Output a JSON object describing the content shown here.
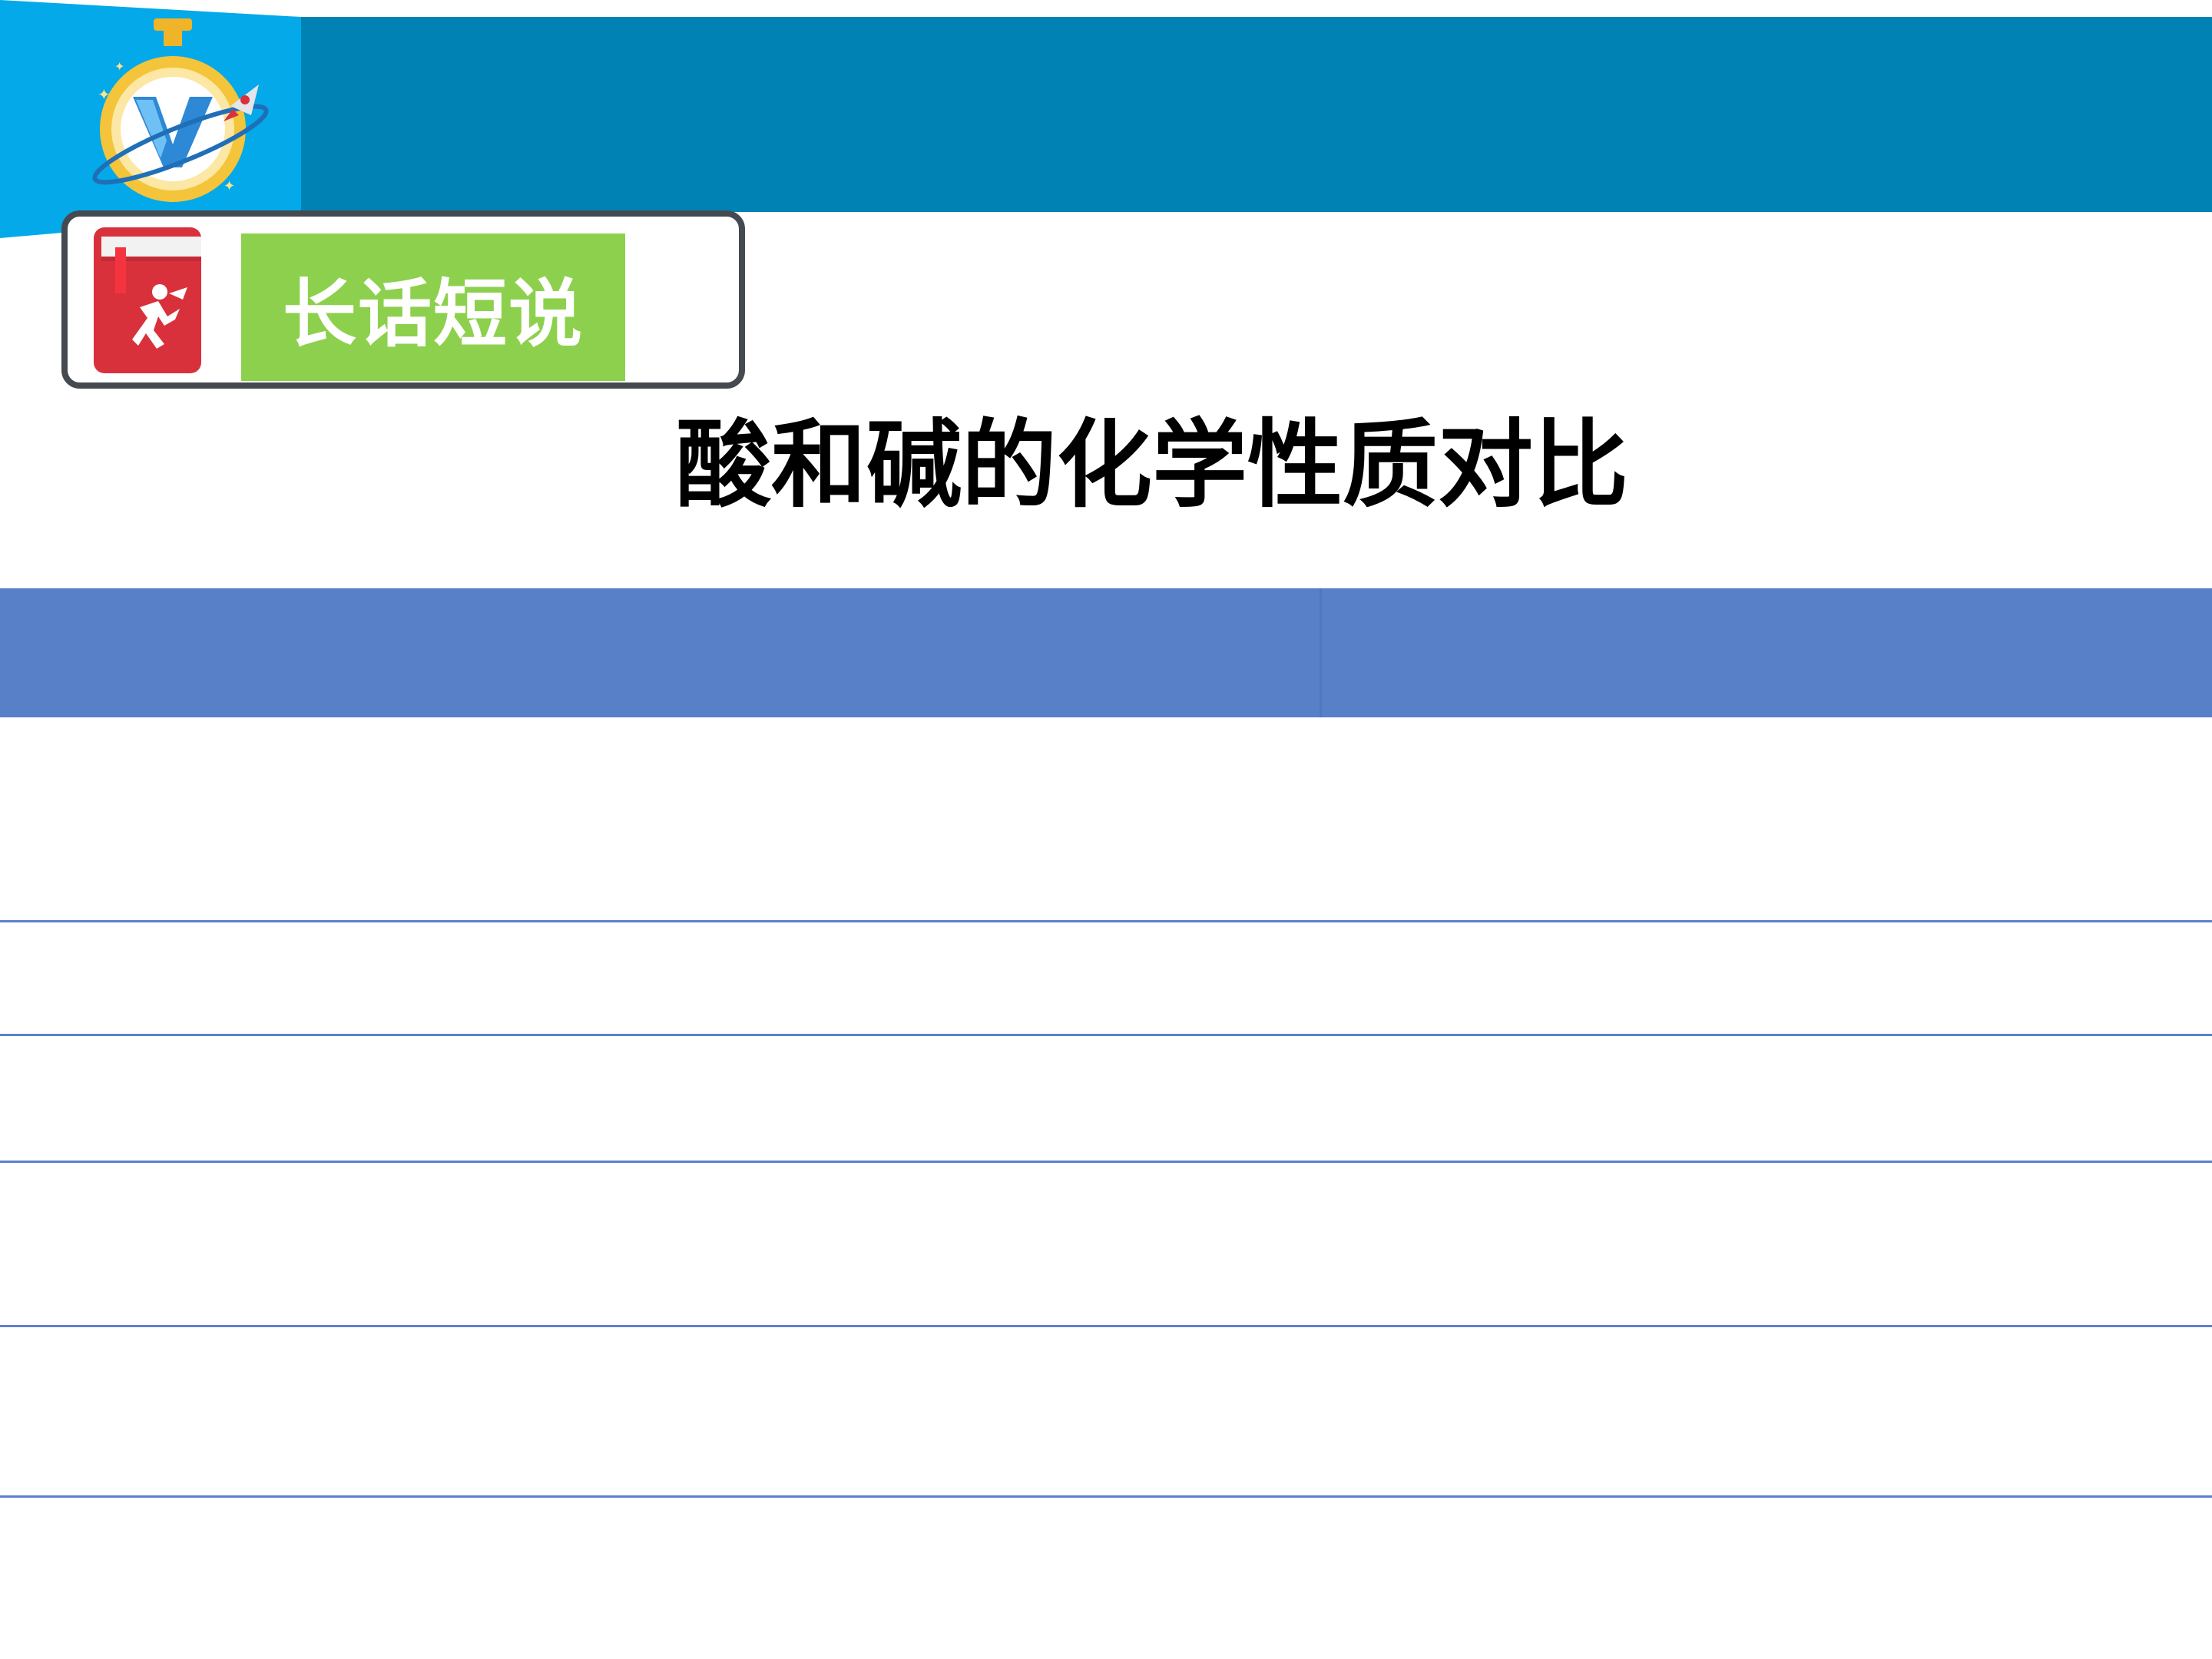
{
  "section_tag": {
    "label": "长话短说"
  },
  "page_title": "酸和碱的化学性质对比",
  "table": {
    "headers": [
      "",
      ""
    ],
    "rows": [
      [
        "",
        ""
      ],
      [
        "",
        ""
      ],
      [
        "",
        ""
      ],
      [
        "",
        ""
      ],
      [
        "",
        ""
      ]
    ]
  },
  "colors": {
    "top_bar": "#0083b4",
    "corner_block": "#03a9e8",
    "tag_label_bg": "#8dd04d",
    "tag_border": "#444a4f",
    "book_icon": "#d9313c",
    "table_header": "#5780c9",
    "table_border": "#5d7fd0",
    "stopwatch": "#f0b429"
  },
  "icons": {
    "logo": "stopwatch-rocket-logo-icon",
    "tag": "red-book-runner-icon"
  }
}
